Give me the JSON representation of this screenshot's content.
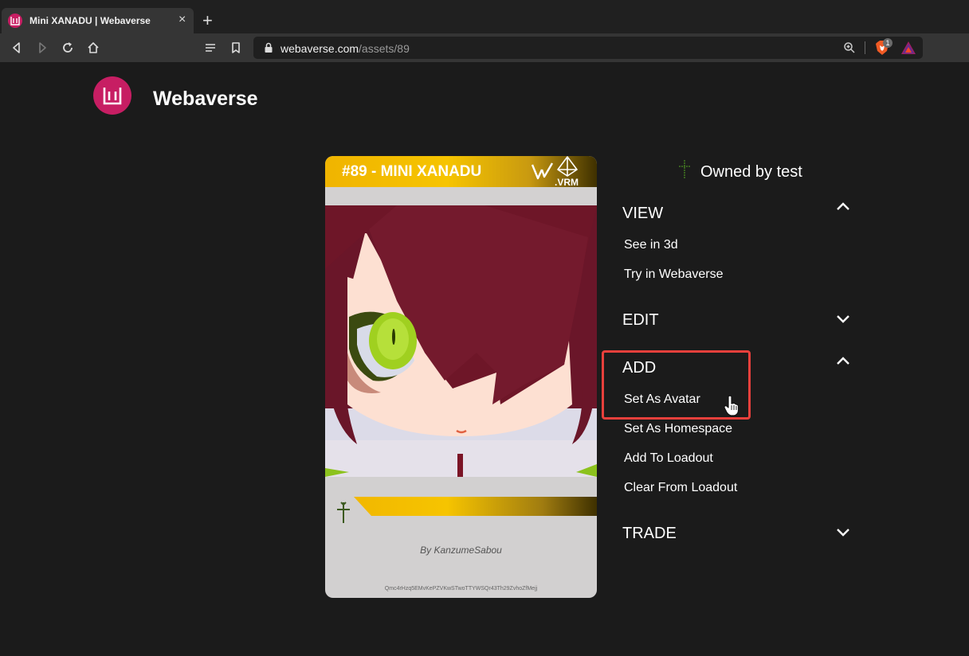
{
  "browser": {
    "tab_title": "Mini XANADU | Webaverse",
    "tab_close": "×",
    "new_tab": "+",
    "url_host": "webaverse.com",
    "url_path": "/assets/89",
    "brave_shield_count": "1"
  },
  "site": {
    "name": "Webaverse"
  },
  "card": {
    "title": "#89 - MINI XANADU",
    "format_label": ".VRM",
    "author": "By KanzumeSabou",
    "hash": "Qmc4rHzq5EMvKePZVKwSTwoTTYWSQr43Th29ZvhoZfMejj"
  },
  "owner": {
    "text": "Owned by test"
  },
  "sections": {
    "view": {
      "title": "VIEW",
      "expanded": true,
      "items": [
        "See in 3d",
        "Try in Webaverse"
      ]
    },
    "edit": {
      "title": "EDIT",
      "expanded": false
    },
    "add": {
      "title": "ADD",
      "expanded": true,
      "items": [
        "Set As Avatar",
        "Set As Homespace",
        "Add To Loadout",
        "Clear From Loadout"
      ]
    },
    "trade": {
      "title": "TRADE",
      "expanded": false
    }
  },
  "colors": {
    "brand": "#c71e63",
    "card_gold": "#f6c400",
    "highlight": "#e8403c"
  }
}
